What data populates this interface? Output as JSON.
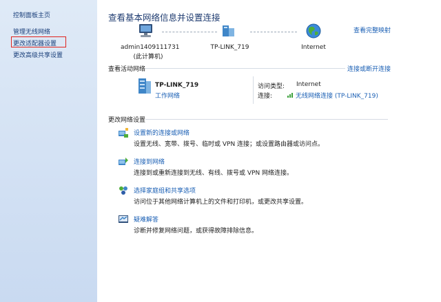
{
  "sidebar": {
    "items": [
      {
        "label": "控制面板主页"
      },
      {
        "label": "管理无线网络"
      },
      {
        "label": "更改适配器设置"
      },
      {
        "label": "更改高级共享设置"
      }
    ]
  },
  "header": {
    "title": "查看基本网络信息并设置连接",
    "full_map": "查看完整映射"
  },
  "map": {
    "computer_name": "admin1409111731",
    "computer_sub": "(此计算机)",
    "router": "TP-LINK_719",
    "internet": "Internet"
  },
  "active": {
    "heading": "查看活动网络",
    "connect_link": "连接或断开连接",
    "network_name": "TP-LINK_719",
    "network_type": "工作网络",
    "access_label": "访问类型:",
    "access_value": "Internet",
    "conn_label": "连接:",
    "conn_value": "无线网络连接 (TP-LINK_719)"
  },
  "settings": {
    "heading": "更改网络设置",
    "tasks": [
      {
        "title": "设置新的连接或网络",
        "desc": "设置无线、宽带、拨号、临时或 VPN 连接；或设置路由器或访问点。"
      },
      {
        "title": "连接到网络",
        "desc": "连接到或重新连接到无线、有线、拨号或 VPN 网络连接。"
      },
      {
        "title": "选择家庭组和共享选项",
        "desc": "访问位于其他网络计算机上的文件和打印机，或更改共享设置。"
      },
      {
        "title": "疑难解答",
        "desc": "诊断并修复网络问题，或获得故障排除信息。"
      }
    ]
  }
}
